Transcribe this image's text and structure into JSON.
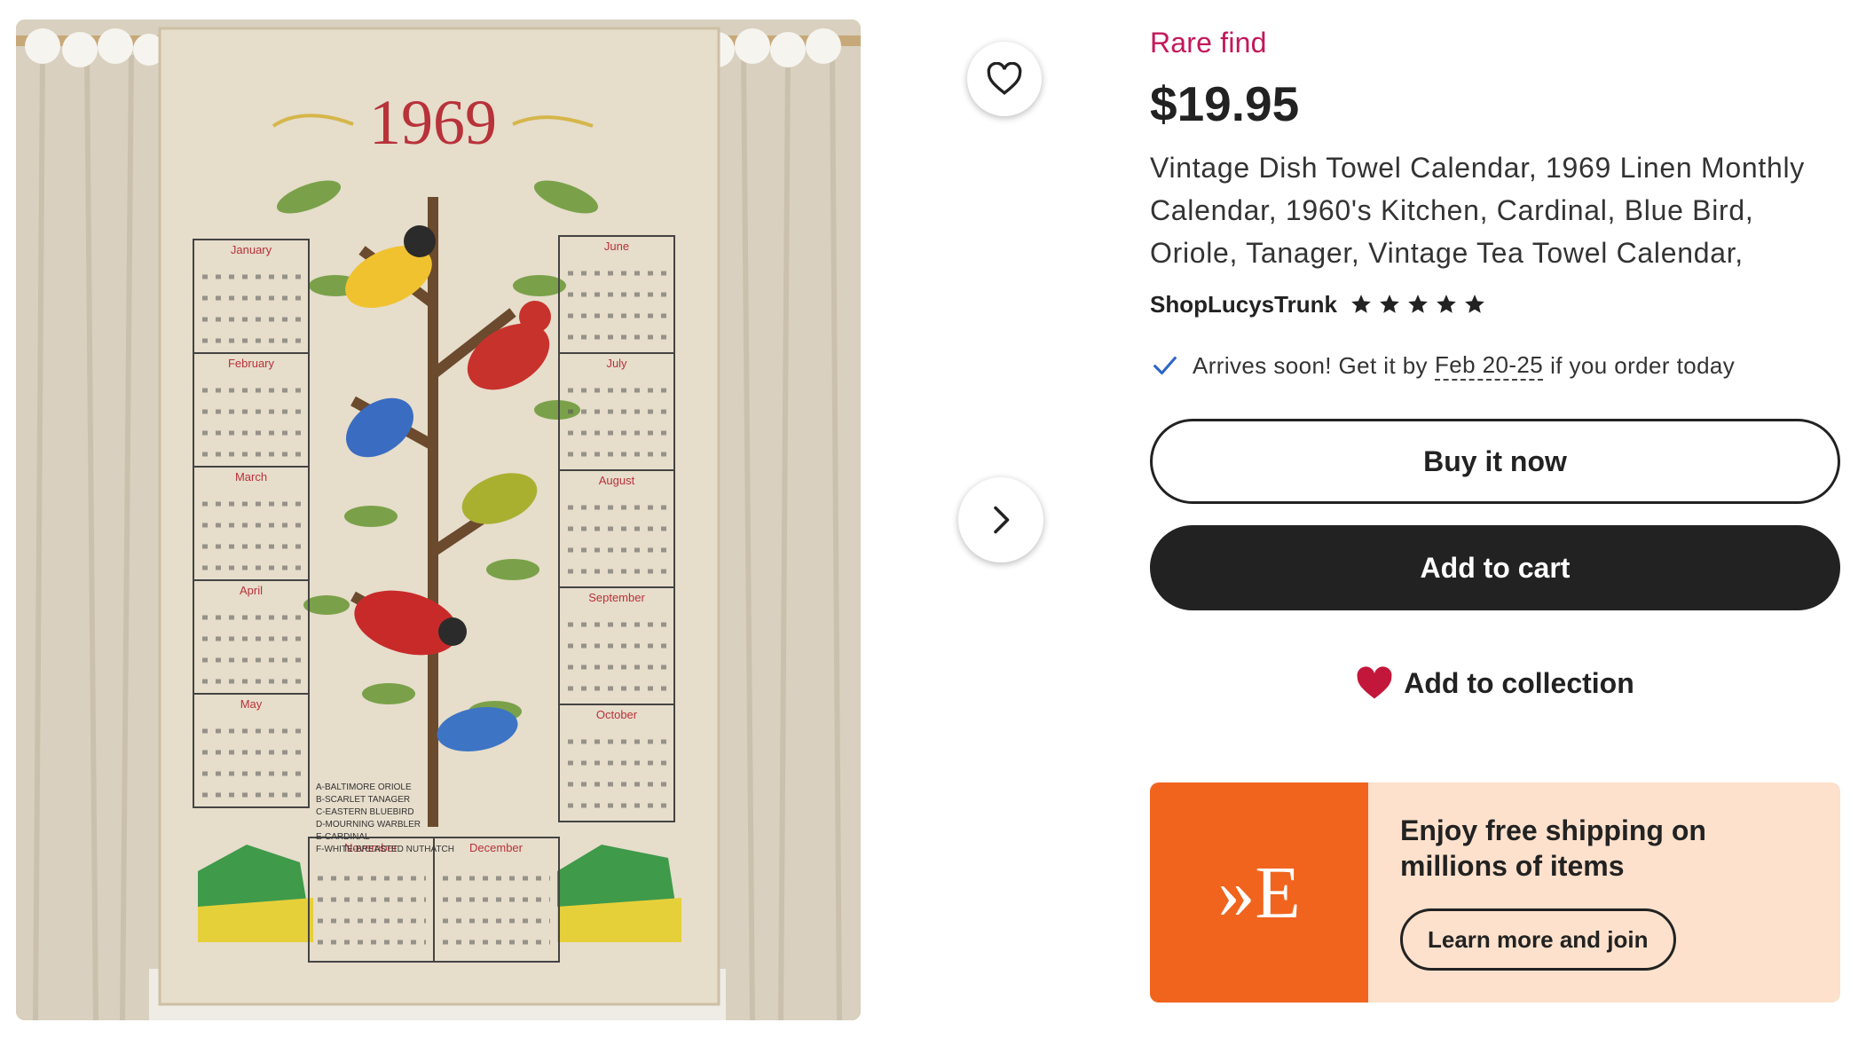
{
  "gallery": {
    "calendar_year": "1969",
    "months": [
      "January",
      "February",
      "March",
      "April",
      "May",
      "June",
      "July",
      "August",
      "September",
      "October",
      "November",
      "December"
    ],
    "bird_legend": [
      "A-BALTIMORE ORIOLE",
      "B-SCARLET TANAGER",
      "C-EASTERN BLUEBIRD",
      "D-MOURNING WARBLER",
      "E-CARDINAL",
      "F-WHITE-BREASTED NUTHATCH"
    ]
  },
  "favorite_icon": "heart-outline-icon",
  "next_icon": "chevron-right-icon",
  "listing": {
    "badge": "Rare find",
    "price": "$19.95",
    "title": "Vintage Dish Towel Calendar, 1969 Linen Monthly Calendar, 1960's Kitchen, Cardinal, Blue Bird, Oriole, Tanager, Vintage Tea Towel Calendar,",
    "shop_name": "ShopLucysTrunk",
    "rating_stars": 5
  },
  "delivery": {
    "prefix": "Arrives soon! Get it by",
    "date_range": "Feb 20-25",
    "suffix": "if you order today"
  },
  "actions": {
    "buy_now": "Buy it now",
    "add_to_cart": "Add to cart",
    "add_to_collection": "Add to collection"
  },
  "promo": {
    "logo_text": "»E",
    "text": "Enjoy free shipping on millions of items",
    "button": "Learn more and join"
  },
  "colors": {
    "badge": "#c2185b",
    "primary_button": "#222222",
    "heart": "#c3163b",
    "promo_accent": "#f1641e",
    "promo_bg": "#fde1cc"
  }
}
